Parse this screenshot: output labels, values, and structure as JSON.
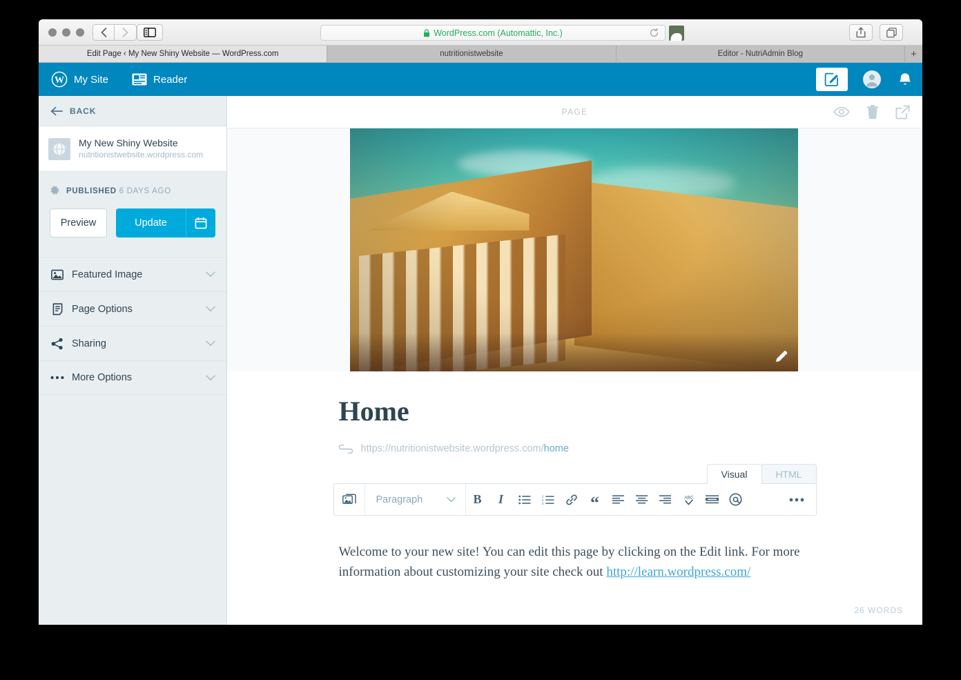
{
  "browser": {
    "address": {
      "text": "WordPress.com (Automattic, Inc.)",
      "lock_icon": "lock-icon",
      "reload_icon": "reload-icon",
      "secure_color": "#2aab5d"
    },
    "tabs": [
      {
        "label": "Edit Page ‹ My New Shiny Website — WordPress.com",
        "active": true
      },
      {
        "label": "nutritionistwebsite",
        "active": false
      },
      {
        "label": "Editor - NutriAdmin Blog",
        "active": false
      }
    ],
    "new_tab_label": "+",
    "back_icon": "chevron-left-icon",
    "forward_icon": "chevron-right-icon",
    "sidebar_toggle_icon": "sidebar-toggle-icon",
    "share_icon": "share-icon",
    "tabs_overview_icon": "tab-overview-icon"
  },
  "wpbar": {
    "brand_icon": "wordpress-logo-icon",
    "my_site_label": "My Site",
    "reader_icon": "reader-icon",
    "reader_label": "Reader",
    "new_post_icon": "compose-icon",
    "avatar_icon": "avatar-icon",
    "notifications_icon": "bell-icon",
    "background_color": "#0087be"
  },
  "sidebar": {
    "back_label": "BACK",
    "back_icon": "arrow-left-icon",
    "site": {
      "icon": "globe-icon",
      "title": "My New Shiny Website",
      "url": "nutritionistwebsite.wordpress.com"
    },
    "status": {
      "icon": "gear-icon",
      "state": "PUBLISHED",
      "when": "6 DAYS AGO"
    },
    "actions": {
      "preview_label": "Preview",
      "update_label": "Update",
      "schedule_icon": "calendar-icon",
      "primary_color": "#00aadc"
    },
    "panels": [
      {
        "label": "Featured Image",
        "icon": "image-icon",
        "chevron": "chevron-down-icon"
      },
      {
        "label": "Page Options",
        "icon": "document-icon",
        "chevron": "chevron-down-icon"
      },
      {
        "label": "Sharing",
        "icon": "share-nodes-icon",
        "chevron": "chevron-down-icon"
      },
      {
        "label": "More Options",
        "icon": "ellipsis-icon",
        "chevron": "chevron-down-icon"
      }
    ]
  },
  "main": {
    "topbar": {
      "page_kind": "PAGE",
      "preview_icon": "eye-icon",
      "trash_icon": "trash-icon",
      "external_icon": "external-link-icon"
    },
    "featured_image": {
      "alt": "Neoclassical stone building with columns under a teal sky",
      "edit_icon": "pencil-icon"
    },
    "post": {
      "title": "Home",
      "permalink_icon": "link-icon",
      "permalink_base": "https://nutritionistwebsite.wordpress.com/",
      "permalink_slug": "home"
    },
    "editor": {
      "tabs": [
        {
          "label": "Visual",
          "active": true
        },
        {
          "label": "HTML",
          "active": false
        }
      ],
      "toolbar": {
        "media_icon": "add-media-icon",
        "format_label": "Paragraph",
        "format_chevron": "chevron-down-icon",
        "buttons": [
          {
            "name": "bold-icon",
            "glyph": "B"
          },
          {
            "name": "italic-icon",
            "glyph": "I"
          },
          {
            "name": "bulleted-list-icon",
            "glyph": ""
          },
          {
            "name": "numbered-list-icon",
            "glyph": ""
          },
          {
            "name": "link-icon",
            "glyph": ""
          },
          {
            "name": "blockquote-icon",
            "glyph": "“"
          },
          {
            "name": "align-left-icon",
            "glyph": ""
          },
          {
            "name": "align-center-icon",
            "glyph": ""
          },
          {
            "name": "align-right-icon",
            "glyph": ""
          },
          {
            "name": "spellcheck-icon",
            "glyph": "ABC"
          },
          {
            "name": "read-more-icon",
            "glyph": ""
          },
          {
            "name": "mention-icon",
            "glyph": "@"
          }
        ],
        "more_icon": "ellipsis-icon"
      },
      "content": {
        "text_before_link": "Welcome to your new site! You can edit this page by clicking on the Edit link. For more information about customizing your site check out ",
        "link_text": "http://learn.wordpress.com/"
      },
      "word_count": "26 WORDS"
    }
  }
}
